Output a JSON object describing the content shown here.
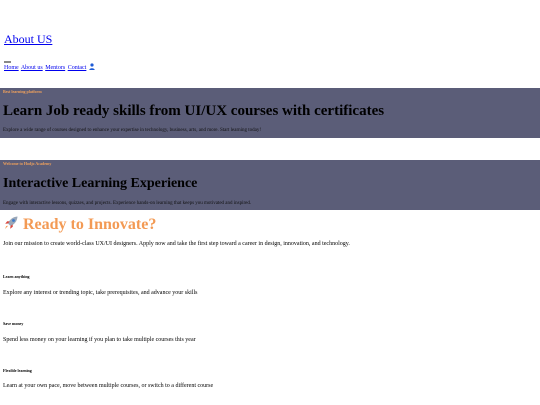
{
  "header": {
    "about_link": "About US"
  },
  "nav": {
    "items": [
      {
        "label": "Home"
      },
      {
        "label": "About us"
      },
      {
        "label": "Mentors"
      },
      {
        "label": "Contact"
      }
    ],
    "user_icon": "user-icon"
  },
  "hero": [
    {
      "eyebrow": "Best learning platform",
      "headline": "Learn Job ready skills from UI/UX courses with certificates",
      "description": "Explore a wide range of courses designed to enhance your expertise in technology, business, arts, and more. Start learning today!"
    },
    {
      "eyebrow": "Welcome to Hodjo Academy",
      "headline": "Interactive Learning Experience",
      "description": "Engage with interactive lessons, quizzes, and projects. Experience hands-on learning that keeps you motivated and inspired."
    }
  ],
  "innovate": {
    "icon": "rocket-icon",
    "title": "Ready to Innovate?",
    "description": "Join our mission to create world-class UX/UI designers. Apply now and take the first step toward a career in design, innovation, and technology."
  },
  "features": [
    {
      "title": "Learn anything",
      "description": "Explore any interest or trending topic, take prerequisites, and advance your skills"
    },
    {
      "title": "Save money",
      "description": "Spend less money on your learning if you plan to take multiple courses this year"
    },
    {
      "title": "Flexible learning",
      "description": "Learn at your own pace, move between multiple courses, or switch to a different course"
    }
  ],
  "colors": {
    "hero_bg": "#5b5d78",
    "accent_orange": "#f39a54",
    "link_blue": "#0000ee"
  }
}
